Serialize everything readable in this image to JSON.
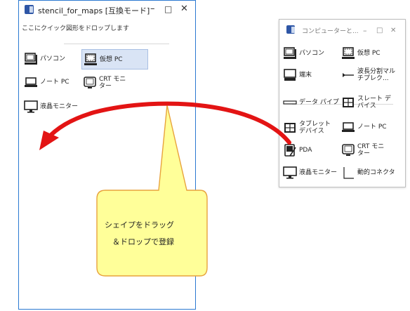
{
  "left_window": {
    "title": "stencil_for_maps  [互換モード]",
    "controls": {
      "minimize": "–",
      "maximize": "□",
      "close": "✕"
    },
    "hint": "ここにクイック図形をドロップします",
    "items": [
      {
        "label": "パソコン",
        "icon": "desktop-pc-icon"
      },
      {
        "label": "仮想 PC",
        "icon": "virtual-pc-icon",
        "selected": true
      },
      {
        "label": "ノート PC",
        "icon": "laptop-icon"
      },
      {
        "label": "CRT モニター",
        "icon": "crt-monitor-icon"
      },
      {
        "label": "液晶モニター",
        "icon": "lcd-monitor-icon"
      }
    ]
  },
  "right_window": {
    "title": "コンピューターと...",
    "controls": {
      "minimize": "–",
      "maximize": "□",
      "close": "✕"
    },
    "items": [
      {
        "label": "パソコン",
        "icon": "desktop-pc-icon"
      },
      {
        "label": "仮想 PC",
        "icon": "virtual-pc-icon"
      },
      {
        "label": "端末",
        "icon": "terminal-icon"
      },
      {
        "label": "波長分割マルチプレク...",
        "icon": "wdm-icon"
      },
      {
        "label": "データ パイプ",
        "icon": "data-pipe-icon"
      },
      {
        "label": "スレート デバイス",
        "icon": "slate-device-icon"
      },
      {
        "label": "タブレット デバイス",
        "icon": "tablet-device-icon"
      },
      {
        "label": "ノート PC",
        "icon": "laptop-icon"
      },
      {
        "label": "PDA",
        "icon": "pda-icon"
      },
      {
        "label": "CRT モニター",
        "icon": "crt-monitor-icon"
      },
      {
        "label": "液晶モニター",
        "icon": "lcd-monitor-icon"
      },
      {
        "label": "動的コネクタ",
        "icon": "dynamic-connector-icon"
      }
    ]
  },
  "callout": {
    "line1": "シェイプをドラッグ",
    "line2": "＆ドロップで登録"
  },
  "colors": {
    "arrow": "#e31414",
    "callout_fill": "#ffff99",
    "callout_border": "#e8a33c",
    "window_border_active": "#2b79d1",
    "selected_item": "#d9e4f5"
  }
}
